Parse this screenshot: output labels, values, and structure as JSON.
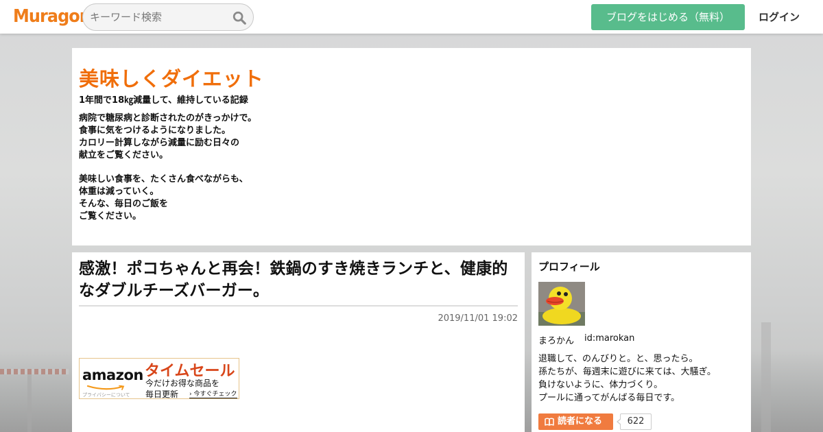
{
  "header": {
    "logo": "Muragon",
    "search_placeholder": "キーワード検索",
    "start_blog_label": "ブログをはじめる（無料）",
    "login_label": "ログイン"
  },
  "blog": {
    "title": "美味しくダイエット",
    "subtitle": "1年間で18㎏減量して、維持している記録",
    "description": [
      [
        "病院で糖尿病と診断されたのがきっかけで。",
        "食事に気をつけるようになりました。",
        "カロリー計算しながら減量に励む日々の",
        "献立をご覧ください。"
      ],
      [
        "美味しい食事を、たくさん食べながらも、",
        "体重は減っていく。",
        "そんな、毎日のご飯を",
        "ご覧ください。"
      ]
    ]
  },
  "article": {
    "title": "感激！ポコちゃんと再会！鉄鍋のすき焼きランチと、健康的なダブルチーズバーガー。",
    "date": "2019/11/01 19:02"
  },
  "ad": {
    "brand": "amazon",
    "sale": "タイムセール",
    "line1": "今だけお得な商品を",
    "line2": "毎日更新",
    "check": "今すぐチェック",
    "privacy": "プライバシーについて"
  },
  "profile": {
    "heading": "プロフィール",
    "name": "まろかん",
    "id": "id:marokan",
    "bio": [
      "退職して、のんびりと。と、思ったら。",
      "孫たちが、毎週末に遊びに来ては、大騒ぎ。",
      "負けないように、体力づくり。",
      "プールに通ってがんばる毎日です。"
    ],
    "follow_label": "読者になる",
    "follower_count": "622"
  },
  "colors": {
    "brand_orange": "#ef7d1a",
    "start_green": "#58bc8c",
    "title_orange": "#f06e0a",
    "follow_orange": "#f07b3f"
  },
  "icons": {
    "search": "search-icon",
    "follow": "book-icon"
  }
}
